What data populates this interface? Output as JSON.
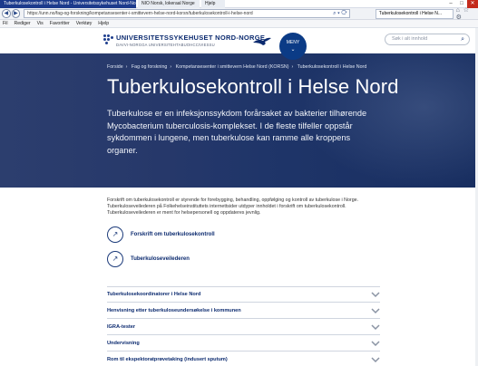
{
  "browser": {
    "tabs": [
      {
        "label": "Tuberkulosekontroll i Helse Nord - Universitetssykehuset Nord-Norge"
      },
      {
        "label": "NIO Norsk, lokeraal Norge"
      },
      {
        "label": "Hjelp"
      }
    ],
    "url": "https://unn.no/fag-og-forskning/kompetansesenter-i-smittevern-helse-nord-korsn/tuberkulosekontroll-i-helse-nord",
    "address_tab": "Tuberkulosekontroll i Helse N...",
    "menu": [
      "Fil",
      "Rediger",
      "Vis",
      "Favoritter",
      "Verktøy",
      "Hjelp"
    ],
    "window_controls": [
      "–",
      "□",
      "✕"
    ],
    "nav": [
      "◀",
      "▶"
    ]
  },
  "site": {
    "logo_title": "UNIVERSITETSSYKEHUSET NORD-NORGE",
    "logo_subtitle": "DAVVI-NORGGA UNIVERSITEHTABUOHCCIVIESSU",
    "menu_label": "MENY",
    "search_placeholder": "Søk i alt innhold"
  },
  "hero": {
    "breadcrumb": [
      "Forside",
      "Fag og forskning",
      "Kompetansesenter i smittevern Helse Nord (KORSN)",
      "Tuberkulosekontroll i Helse Nord"
    ],
    "title": "Tuberkulosekontroll i Helse Nord",
    "lead": "Tuberkulose er en infeksjonssykdom forårsaket av bakterier tilhørende Mycobacterium tuberculosis-komplekset. I de fleste tilfeller oppstår sykdommen i lungene, men tuberkulose kan ramme alle kroppens organer."
  },
  "intro": "Forskrift om tuberkulosekontroll er styrende for forebygging, behandling, oppfølging og kontroll av tuberkulose i Norge. Tuberkuloseveilederen på Folkehelseinstituttets internettsider utdyper innholdet i forskrift om tuberkulosekontroll. Tuberkuloseveilederen er ment for helsepersonell og oppdateres jevnlig.",
  "links": [
    {
      "label": "Forskrift om tuberkulosekontroll",
      "icon": "arrow-up-right-icon"
    },
    {
      "label": "Tuberkuloseveilederen",
      "icon": "arrow-up-right-icon"
    }
  ],
  "accordion": [
    {
      "label": "Tuberkulosekoordinatorer i Helse Nord"
    },
    {
      "label": "Henvisning etter tuberkuloseundersøkelse i kommunen"
    },
    {
      "label": "IGRA-tester"
    },
    {
      "label": "Undervisning"
    },
    {
      "label": "Rom til ekspektoratprøvetaking (indusert sputum)"
    }
  ],
  "colors": {
    "brand": "#0b2a6f",
    "hero_bg": "#26386a",
    "accent": "#0b3b86"
  }
}
